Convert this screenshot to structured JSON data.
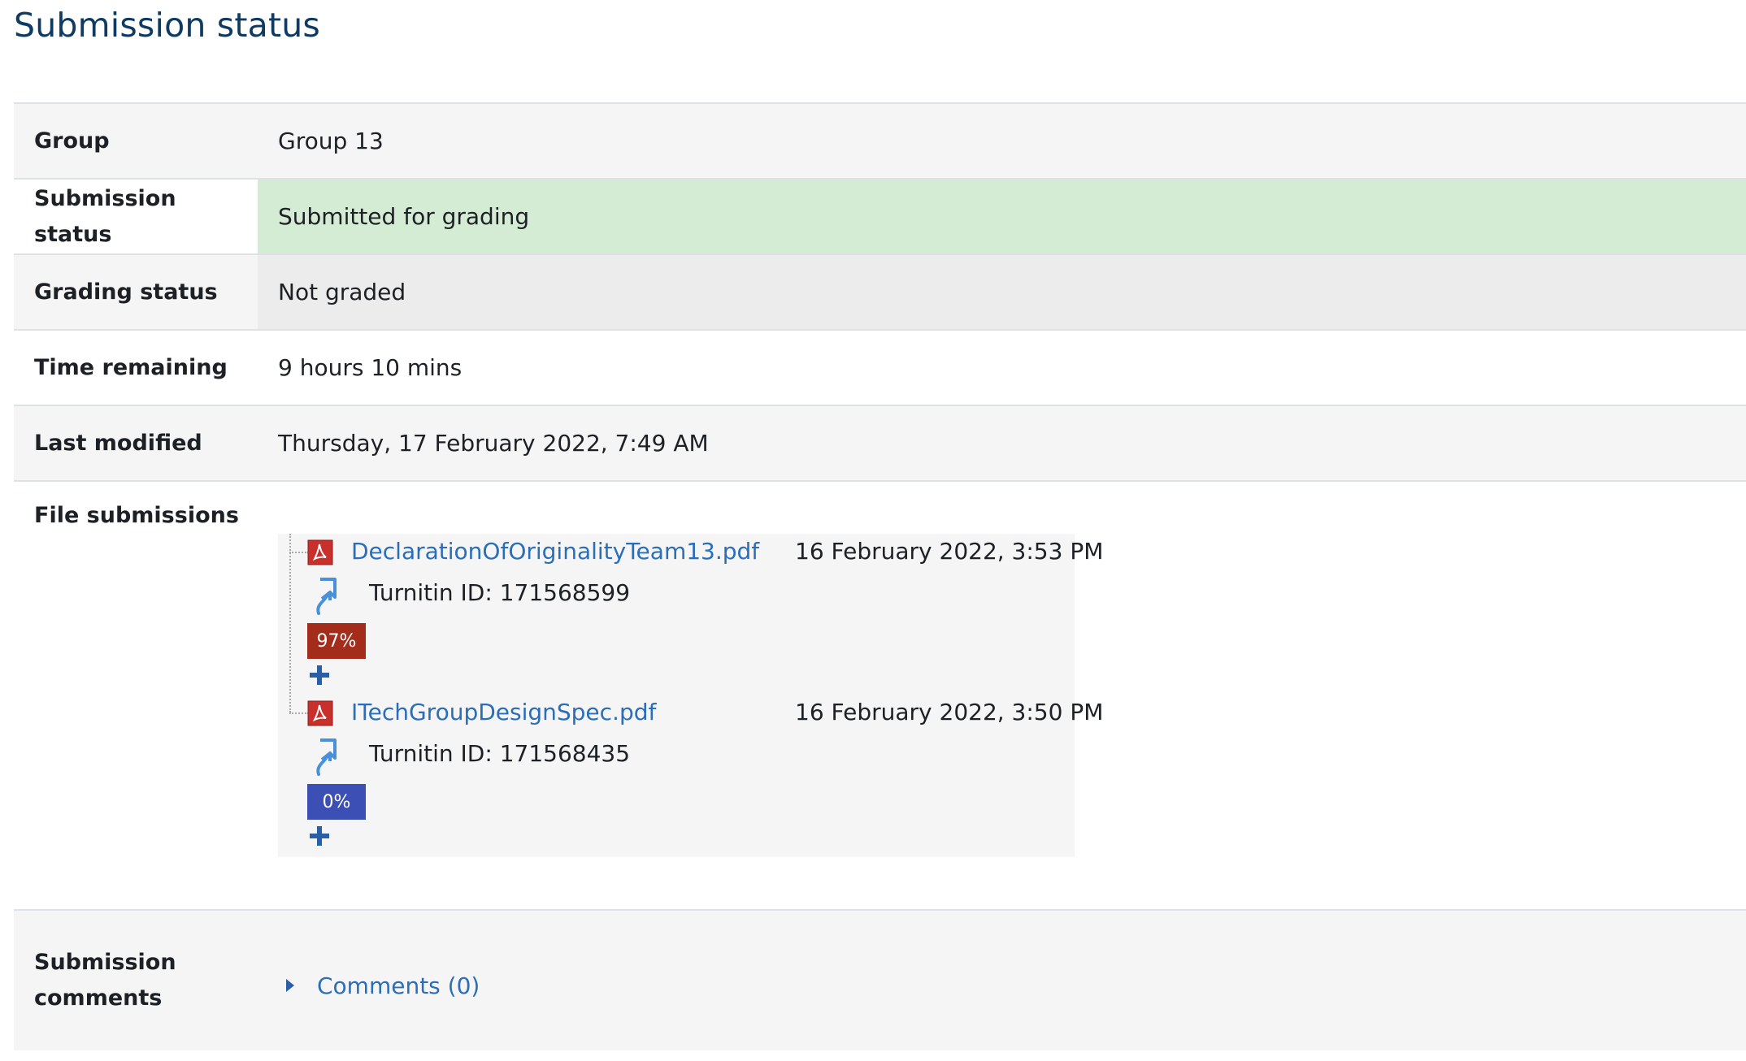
{
  "title": "Submission status",
  "rows": {
    "group": {
      "label": "Group",
      "value": "Group 13"
    },
    "submission_status": {
      "label": "Submission status",
      "value": "Submitted for grading"
    },
    "grading_status": {
      "label": "Grading status",
      "value": "Not graded"
    },
    "time_remaining": {
      "label": "Time remaining",
      "value": "9 hours 10 mins"
    },
    "last_modified": {
      "label": "Last modified",
      "value": "Thursday, 17 February 2022, 7:49 AM"
    },
    "file_submissions": {
      "label": "File submissions"
    },
    "submission_comments": {
      "label_line1": "Submission",
      "label_line2": "comments",
      "comments_link": "Comments (0)"
    }
  },
  "files": [
    {
      "name": "DeclarationOfOriginalityTeam13.pdf",
      "date": "16 February 2022, 3:53 PM",
      "turnitin_id": "Turnitin ID: 171568599",
      "score": "97%",
      "score_color": "#a32d1a",
      "icon": "pdf-icon"
    },
    {
      "name": "ITechGroupDesignSpec.pdf",
      "date": "16 February 2022, 3:50 PM",
      "turnitin_id": "Turnitin ID: 171568435",
      "score": "0%",
      "score_color": "#3c4fb5",
      "icon": "pdf-icon"
    }
  ],
  "colors": {
    "title": "#0f3b63",
    "link": "#2a6ebb",
    "submitted_bg": "#d5ecd4",
    "not_graded_bg": "#ececec",
    "row_alt_bg": "#f5f5f5"
  }
}
